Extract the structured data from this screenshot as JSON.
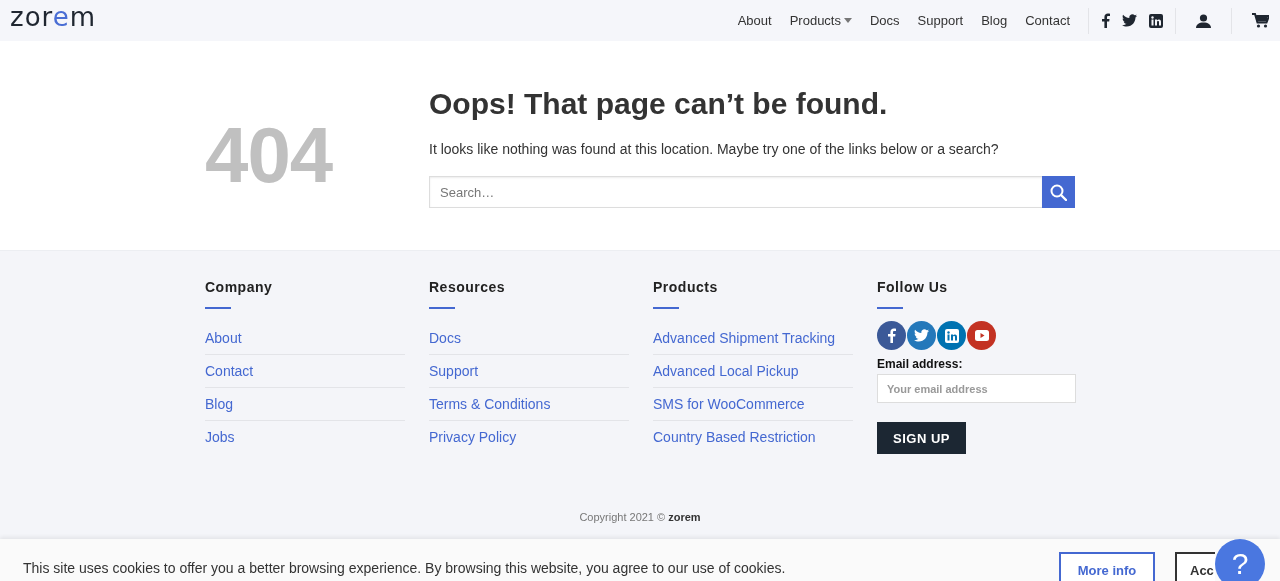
{
  "header": {
    "logo": [
      {
        "text": "zor",
        "accent": false
      },
      {
        "text": "e",
        "accent": true
      },
      {
        "text": "m",
        "accent": false
      }
    ],
    "nav": [
      {
        "label": "About",
        "dropdown": false
      },
      {
        "label": "Products",
        "dropdown": true
      },
      {
        "label": "Docs",
        "dropdown": false
      },
      {
        "label": "Support",
        "dropdown": false
      },
      {
        "label": "Blog",
        "dropdown": false
      },
      {
        "label": "Contact",
        "dropdown": false
      }
    ],
    "social": [
      {
        "kind": "facebook"
      },
      {
        "kind": "twitter"
      },
      {
        "kind": "linkedin"
      }
    ]
  },
  "error": {
    "code": "404",
    "title": "Oops! That page can’t be found.",
    "message": "It looks like nothing was found at this location. Maybe try one of the links below or a search?",
    "search": {
      "placeholder": "Search…"
    }
  },
  "footer": {
    "columns": [
      {
        "heading": "Company",
        "links": [
          "About",
          "Contact",
          "Blog",
          "Jobs"
        ]
      },
      {
        "heading": "Resources",
        "links": [
          "Docs",
          "Support",
          "Terms & Conditions",
          "Privacy Policy"
        ]
      },
      {
        "heading": "Products",
        "links": [
          "Advanced Shipment Tracking",
          "Advanced Local Pickup",
          "SMS for WooCommerce",
          "Country Based Restriction"
        ]
      }
    ],
    "follow": {
      "heading": "Follow Us",
      "social": [
        {
          "kind": "facebook",
          "color": "#3b5998"
        },
        {
          "kind": "twitter",
          "color": "#2478ba"
        },
        {
          "kind": "linkedin",
          "color": "#0072b1"
        },
        {
          "kind": "youtube",
          "color": "#c33223"
        }
      ],
      "email_label": "Email address:",
      "email": {
        "placeholder": "Your email address"
      },
      "button": "SIGN UP"
    },
    "copyright": {
      "text": "Copyright 2021 ©",
      "brand": "zorem"
    }
  },
  "cookie_bar": {
    "message": "This site uses cookies to offer you a better browsing experience. By browsing this website, you agree to our use of cookies.",
    "more_info": "More info",
    "accept": "Acc"
  },
  "help_button": {
    "label": "?"
  }
}
